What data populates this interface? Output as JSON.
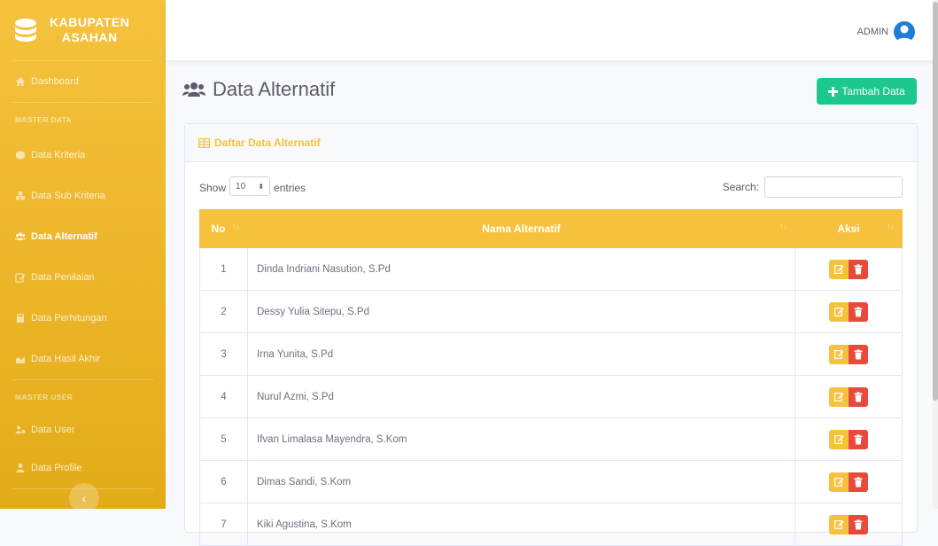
{
  "brand": {
    "line1": "KABUPATEN",
    "line2": "ASAHAN"
  },
  "sidebar": {
    "dashboard": "Dashboard",
    "heading_master_data": "MASTER DATA",
    "items": [
      "Data Kriteria",
      "Data Sub Kriteria",
      "Data Alternatif",
      "Data Penilaian",
      "Data Perhitungan",
      "Data Hasil Akhir"
    ],
    "active": "Data Alternatif",
    "heading_master_user": "MASTER USER",
    "user_items": [
      "Data User",
      "Data Profile"
    ],
    "toggle_icon": "chevron-left-icon"
  },
  "topbar": {
    "user": "ADMIN"
  },
  "page": {
    "title": "Data Alternatif",
    "add_button": "Tambah Data"
  },
  "card": {
    "title": "Daftar Data Alternatif"
  },
  "controls": {
    "show": "Show",
    "entries_value": "10",
    "entries": "entries",
    "search": "Search:"
  },
  "table": {
    "headers": [
      "No",
      "Nama Alternatif",
      "Aksi"
    ],
    "rows": [
      {
        "no": "1",
        "name": "Dinda Indriani Nasution, S.Pd"
      },
      {
        "no": "2",
        "name": "Dessy Yulia Sitepu, S.Pd"
      },
      {
        "no": "3",
        "name": "Irna Yunita, S.Pd"
      },
      {
        "no": "4",
        "name": "Nurul Azmi, S.Pd"
      },
      {
        "no": "5",
        "name": "Ifvan Limalasa Mayendra, S.Kom"
      },
      {
        "no": "6",
        "name": "Dimas Sandi, S.Kom"
      },
      {
        "no": "7",
        "name": "Kiki Agustina, S.Kom"
      }
    ]
  },
  "colors": {
    "primary": "#f6c23e",
    "success": "#1cc88a",
    "danger": "#e74a3b",
    "avatar": "#1c7ed6"
  }
}
